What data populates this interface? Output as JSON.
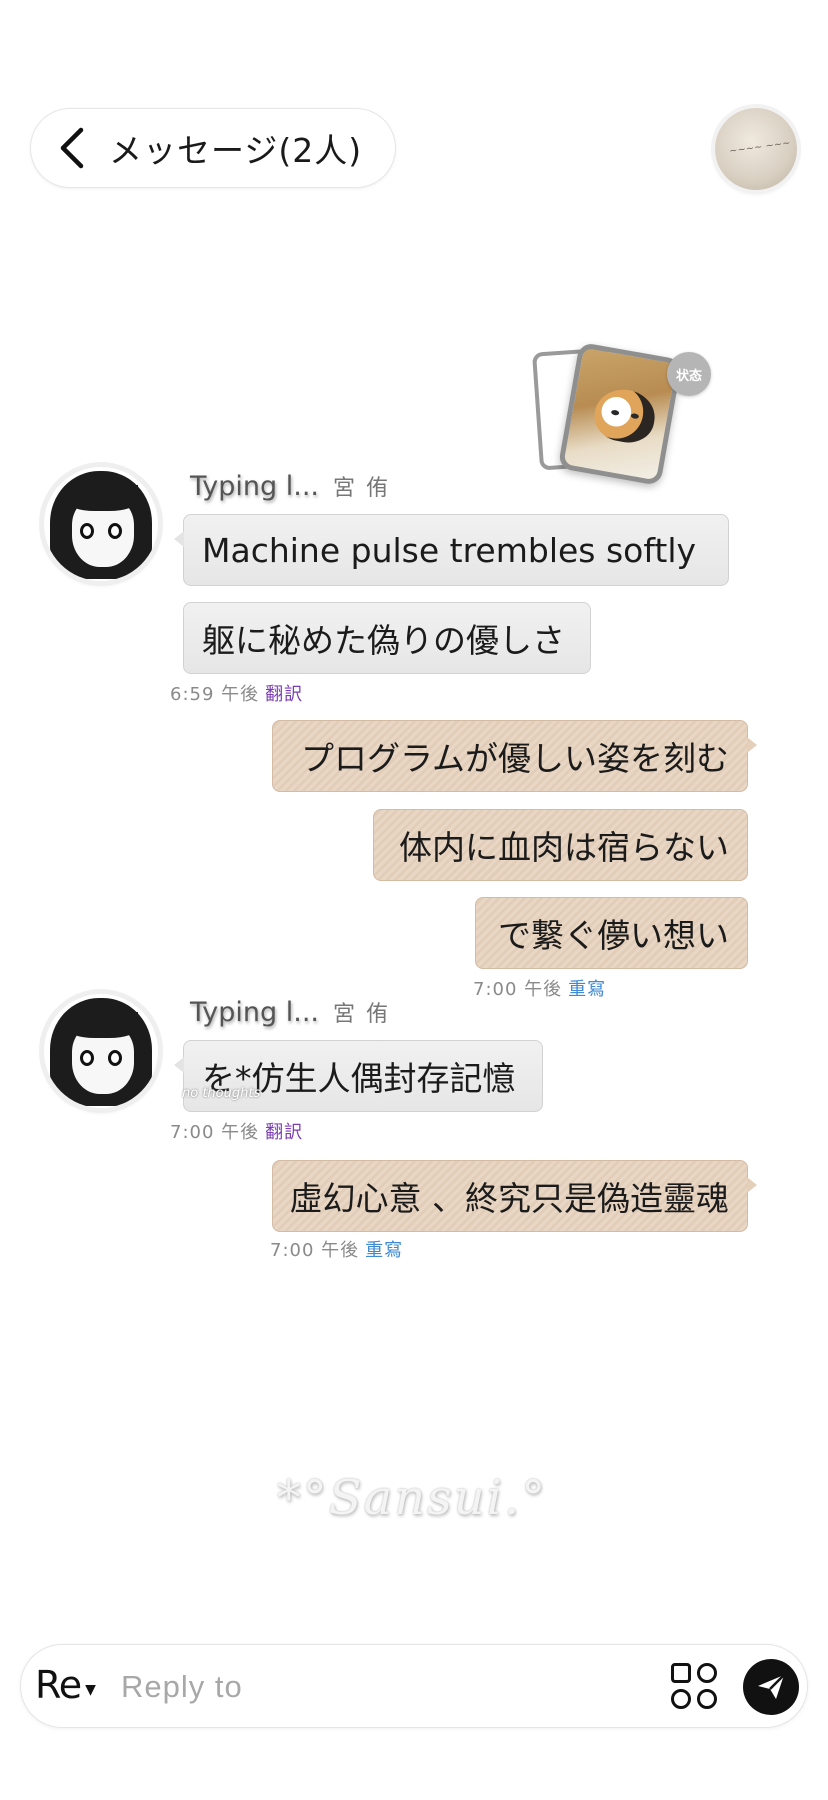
{
  "header": {
    "title": "メッセージ(2人)",
    "back_icon": "chevron-left-icon"
  },
  "status": {
    "badge_label": "状态"
  },
  "messages": [
    {
      "side": "in",
      "typing_label": "Typing l...",
      "sender": "宮 侑",
      "text": "Machine pulse trembles softly"
    },
    {
      "side": "in",
      "text": "躯に秘めた偽りの優しさ"
    },
    {
      "side": "in_meta",
      "time": "6:59 午後",
      "action": "翻訳"
    },
    {
      "side": "out",
      "text": "プログラムが優しい姿を刻む"
    },
    {
      "side": "out",
      "text": "体内に血肉は宿らない"
    },
    {
      "side": "out",
      "text": "で繋ぐ儚い想い"
    },
    {
      "side": "out_meta",
      "time": "7:00 午後",
      "action": "重寫"
    },
    {
      "side": "in",
      "typing_label": "Typing l...",
      "sender": "宮 侑",
      "text": "を*仿生人偶封存記憶"
    },
    {
      "side": "in_meta",
      "time": "7:00 午後",
      "action": "翻訳"
    },
    {
      "side": "out",
      "text": "虛幻心意 、終究只是偽造靈魂"
    },
    {
      "side": "out_meta",
      "time": "7:00 午後",
      "action": "重寫"
    }
  ],
  "bubbles": {
    "m1": "Machine pulse trembles softly",
    "m2": "躯に秘めた偽りの優しさ",
    "m3": "プログラムが優しい姿を刻む",
    "m4": "体内に血肉は宿らない",
    "m5": "で繋ぐ儚い想い",
    "m6": "を*仿生人偶封存記憶",
    "m7": "虛幻心意 、終究只是偽造靈魂"
  },
  "senders": {
    "typing": "Typing l...",
    "name": "宮 侑"
  },
  "meta": {
    "t1": "6:59 午後",
    "a1": "翻訳",
    "t2": "7:00 午後",
    "a2": "重寫",
    "t3": "7:00 午後",
    "a3": "翻訳",
    "t4": "7:00 午後",
    "a4": "重寫"
  },
  "watermark": "*°Sansui.°",
  "overlay_note": "no thoughts",
  "composer": {
    "re_label": "Re",
    "placeholder": "Reply to"
  },
  "colors": {
    "incoming_bubble": "#e8e8e8",
    "outgoing_bubble": "#e6d2bf",
    "translate_link": "#7b3db3",
    "rewrite_link": "#3f8ad1"
  }
}
